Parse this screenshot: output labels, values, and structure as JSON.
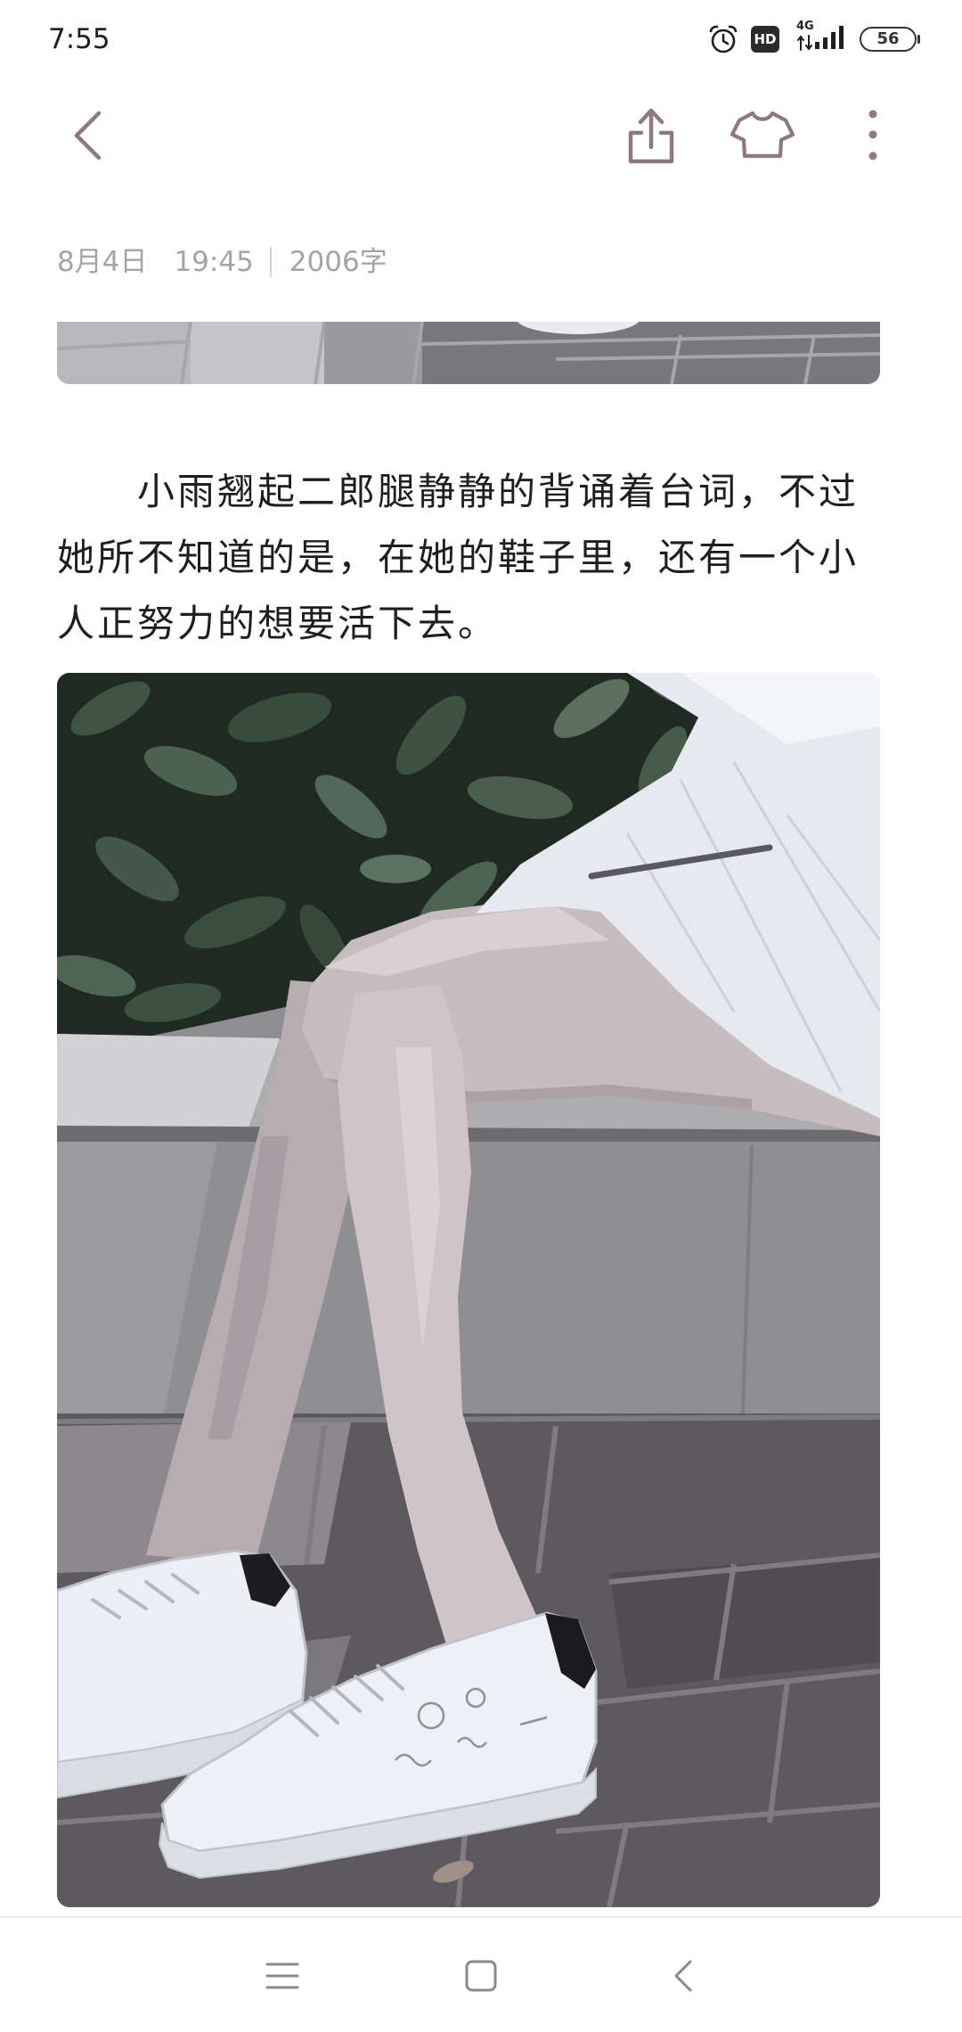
{
  "status_bar": {
    "time": "7:55",
    "hd_badge": "HD",
    "network_type": "4G",
    "battery_level": "56",
    "icons": [
      "alarm-icon",
      "hd-icon",
      "network-arrows-icon",
      "signal-icon",
      "battery-icon"
    ]
  },
  "toolbar": {
    "icons": [
      "back-icon",
      "share-icon",
      "theme-tshirt-icon",
      "more-vertical-icon"
    ]
  },
  "note": {
    "date": "8月4日",
    "time": "19:45",
    "word_count": "2006字",
    "body": "小雨翘起二郎腿静静的背诵着台词，不过她所不知道的是，在她的鞋子里，还有一个小人正努力的想要活下去。"
  },
  "nav_bar": {
    "icons": [
      "menu-icon",
      "home-icon",
      "back-icon"
    ]
  },
  "colors": {
    "background": "#ffffff",
    "status_text": "#1f1f1f",
    "accent_icon": "#8e7a7d",
    "meta_text": "#a4a4a4",
    "divider": "#d6d6d6",
    "body_text": "#1f1f1f",
    "nav_icon": "#8a8a8a"
  }
}
